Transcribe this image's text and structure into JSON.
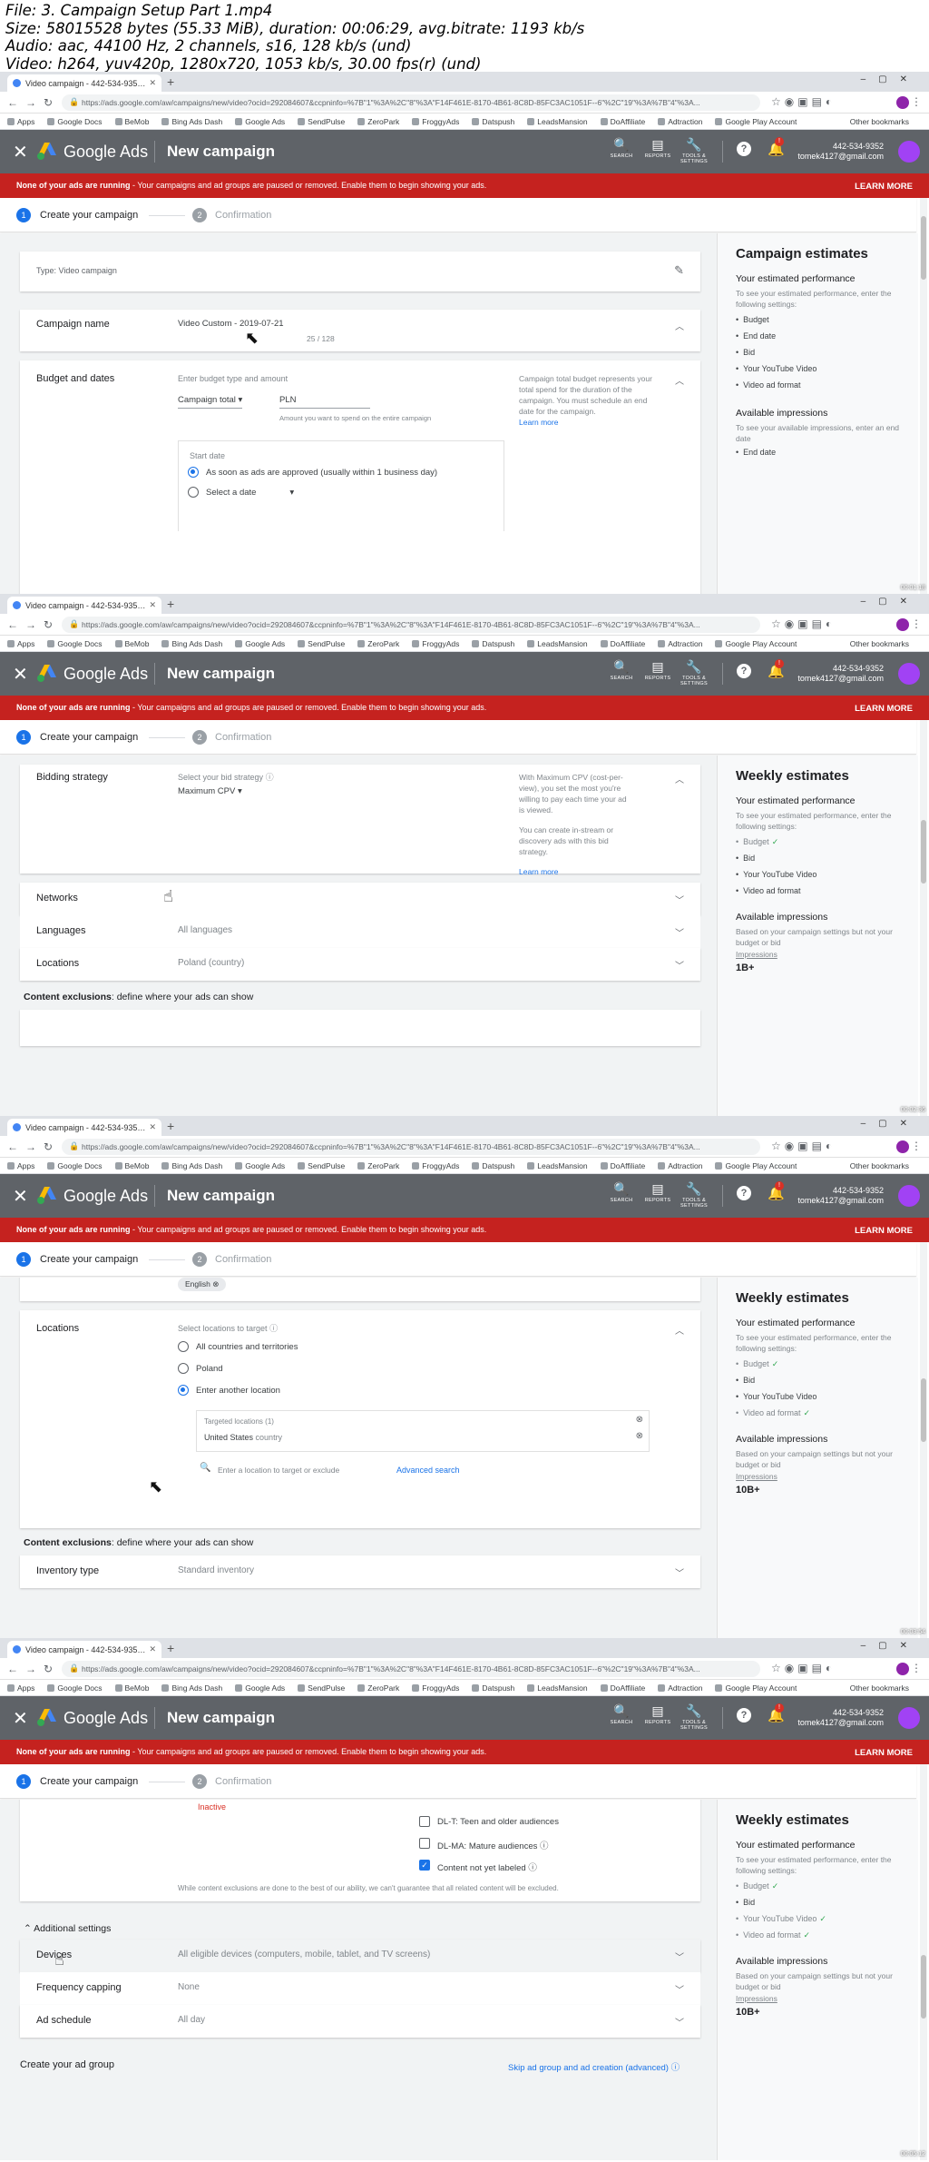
{
  "file_info": {
    "line1": "File: 3. Campaign Setup Part 1.mp4",
    "line2": "Size: 58015528 bytes (55.33 MiB), duration: 00:06:29, avg.bitrate: 1193 kb/s",
    "line3": "Audio: aac, 44100 Hz, 2 channels, s16, 128 kb/s (und)",
    "line4": "Video: h264, yuv420p, 1280x720, 1053 kb/s, 30.00 fps(r) (und)"
  },
  "browser": {
    "tab_title": "Video campaign - 442-534-935…",
    "url": "https://ads.google.com/aw/campaigns/new/video?ocid=292084607&ccpninfo=%7B\"1\"%3A%2C\"8\"%3A\"F14F461E-8170-4B61-8C8D-85FC3AC1051F--6\"%2C\"19\"%3A%7B\"4\"%3A...",
    "bookmarks": [
      "Apps",
      "Google Docs",
      "BeMob",
      "Bing Ads Dash",
      "Google Ads",
      "SendPulse",
      "ZeroPark",
      "FroggyAds",
      "Datspush",
      "LeadsMansion",
      "DoAffiliate",
      "Adtraction",
      "Google Play Account"
    ],
    "other_bookmarks": "Other bookmarks"
  },
  "header": {
    "brand": "Google Ads",
    "title": "New campaign",
    "search_label": "SEARCH",
    "reports_label": "REPORTS",
    "tools_label": "TOOLS & SETTINGS",
    "help": "?",
    "bell_badge": "!",
    "account_id": "442-534-9352",
    "account_email": "tomek4127@gmail.com"
  },
  "alert": {
    "strong": "None of your ads are running",
    "rest": " - Your campaigns and ad groups are paused or removed. Enable them to begin showing your ads.",
    "learn_more": "LEARN MORE"
  },
  "stepper": {
    "step1_num": "1",
    "step1_label": "Create your campaign",
    "step2_num": "2",
    "step2_label": "Confirmation"
  },
  "frame1": {
    "type_text": "Type: Video campaign",
    "campaign_name_label": "Campaign name",
    "campaign_name_value": "Video Custom - 2019-07-21",
    "char_count": "25 / 128",
    "budget_label": "Budget and dates",
    "budget_hint": "Enter budget type and amount",
    "budget_type": "Campaign total",
    "currency": "PLN",
    "amount_hint": "Amount you want to spend on the entire campaign",
    "budget_help": "Campaign total budget represents your total spend for the duration of the campaign. You must schedule an end date for the campaign.",
    "learn_more": "Learn more",
    "start_date_label": "Start date",
    "opt1": "As soon as ads are approved (usually within 1 business day)",
    "opt2": "Select a date",
    "side_title": "Campaign estimates",
    "side_perf": "Your estimated performance",
    "side_perf_txt": "To see your estimated performance, enter the following settings:",
    "side_list": [
      "Budget",
      "End date",
      "Bid",
      "Your YouTube Video",
      "Video ad format"
    ],
    "side_avail": "Available impressions",
    "side_avail_txt": "To see your available impressions, enter an end date",
    "side_list2": [
      "End date"
    ]
  },
  "frame2": {
    "bidding_label": "Bidding strategy",
    "bid_hint": "Select your bid strategy",
    "bid_value": "Maximum CPV",
    "bid_help1": "With Maximum CPV (cost-per-view), you set the most you're willing to pay each time your ad is viewed.",
    "bid_help2": "You can create in-stream or discovery ads with this bid strategy.",
    "learn_more": "Learn more",
    "networks_label": "Networks",
    "languages_label": "Languages",
    "languages_value": "All languages",
    "locations_label": "Locations",
    "locations_value": "Poland (country)",
    "exclusions_bold": "Content exclusions",
    "exclusions_rest": ": define where your ads can show",
    "side_title": "Weekly estimates",
    "side_perf": "Your estimated performance",
    "side_perf_txt": "To see your estimated performance, enter the following settings:",
    "side_list": [
      "Budget",
      "Bid",
      "Your YouTube Video",
      "Video ad format"
    ],
    "side_avail": "Available impressions",
    "side_avail_txt": "Based on your campaign settings but not your budget or bid",
    "impressions_label": "Impressions",
    "impressions_value": "1B+"
  },
  "frame3": {
    "language_chip": "English",
    "locations_label": "Locations",
    "locations_hint": "Select locations to target",
    "opt1": "All countries and territories",
    "opt2": "Poland",
    "opt3": "Enter another location",
    "targeted_header": "Targeted locations (1)",
    "targeted_value": "United States",
    "targeted_type": "country",
    "search_placeholder": "Enter a location to target or exclude",
    "advanced_search": "Advanced search",
    "exclusions_bold": "Content exclusions",
    "exclusions_rest": ": define where your ads can show",
    "inventory_label": "Inventory type",
    "inventory_value": "Standard inventory",
    "side_title": "Weekly estimates",
    "side_perf": "Your estimated performance",
    "side_perf_txt": "To see your estimated performance, enter the following settings:",
    "side_list": [
      "Budget",
      "Bid",
      "Your YouTube Video",
      "Video ad format"
    ],
    "side_avail": "Available impressions",
    "side_avail_txt": "Based on your campaign settings but not your budget or bid",
    "impressions_label": "Impressions",
    "impressions_value": "10B+"
  },
  "frame4": {
    "inactive": "Inactive",
    "chk1": "DL-T: Teen and older audiences",
    "chk2": "DL-MA: Mature audiences",
    "chk3": "Content not yet labeled",
    "disclaimer": "While content exclusions are done to the best of our ability, we can't guarantee that all related content will be excluded.",
    "additional": "Additional settings",
    "devices_label": "Devices",
    "devices_value": "All eligible devices (computers, mobile, tablet, and TV screens)",
    "freq_label": "Frequency capping",
    "freq_value": "None",
    "schedule_label": "Ad schedule",
    "schedule_value": "All day",
    "create_adgroup": "Create your ad group",
    "skip": "Skip ad group and ad creation (advanced)",
    "side_title": "Weekly estimates",
    "side_perf": "Your estimated performance",
    "side_perf_txt": "To see your estimated performance, enter the following settings:",
    "side_list": [
      "Budget",
      "Bid",
      "Your YouTube Video",
      "Video ad format"
    ],
    "side_avail": "Available impressions",
    "side_avail_txt": "Based on your campaign settings but not your budget or bid",
    "impressions_label": "Impressions",
    "impressions_value": "10B+"
  },
  "timestamps": [
    "00:01:18",
    "00:02:36",
    "00:03:54",
    "00:05:12"
  ],
  "colors": {
    "alert": "#c5221f",
    "header": "#5f6368",
    "accent": "#1a73e8",
    "check": "#34a853"
  }
}
